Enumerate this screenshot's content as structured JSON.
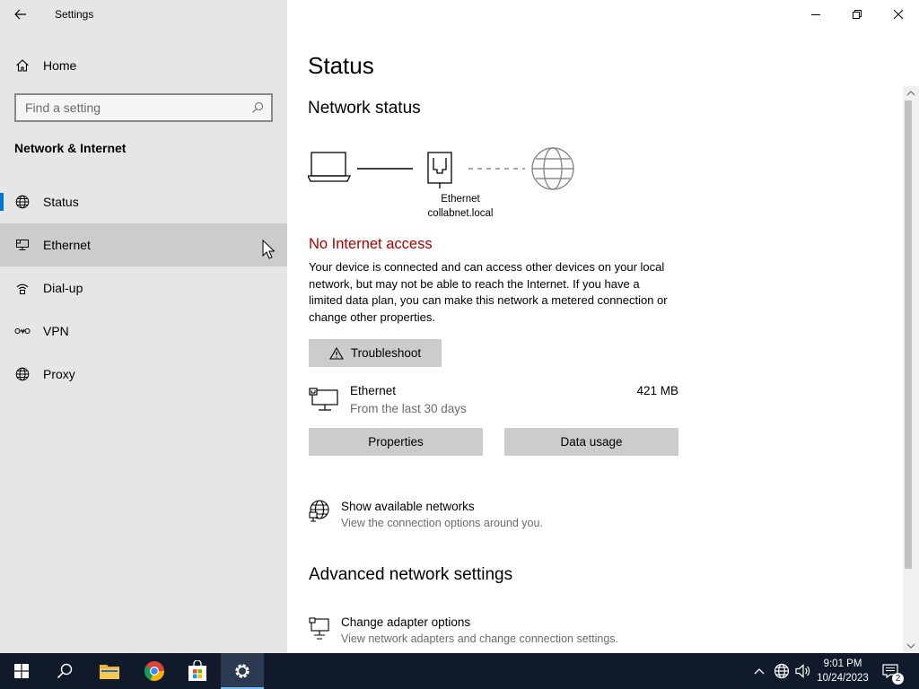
{
  "window": {
    "title": "Settings"
  },
  "sidebar": {
    "home_label": "Home",
    "search_placeholder": "Find a setting",
    "section_title": "Network & Internet",
    "items": [
      {
        "label": "Status",
        "icon": "globe-icon",
        "selected": true
      },
      {
        "label": "Ethernet",
        "icon": "ethernet-icon",
        "hovered": true
      },
      {
        "label": "Dial-up",
        "icon": "dialup-icon"
      },
      {
        "label": "VPN",
        "icon": "vpn-icon"
      },
      {
        "label": "Proxy",
        "icon": "globe-icon"
      }
    ]
  },
  "main": {
    "page_title": "Status",
    "network_status_heading": "Network status",
    "diagram": {
      "adapter_name": "Ethernet",
      "network_name": "collabnet.local"
    },
    "alert_title": "No Internet access",
    "description": "Your device is connected and can access other devices on your local network, but may not be able to reach the Internet. If you have a limited data plan, you can make this network a metered connection or change other properties.",
    "troubleshoot_label": "Troubleshoot",
    "connection": {
      "name": "Ethernet",
      "subtitle": "From the last 30 days",
      "data_used": "421 MB"
    },
    "properties_label": "Properties",
    "data_usage_label": "Data usage",
    "show_networks": {
      "title": "Show available networks",
      "subtitle": "View the connection options around you."
    },
    "advanced_heading": "Advanced network settings",
    "change_adapter": {
      "title": "Change adapter options",
      "subtitle": "View network adapters and change connection settings."
    }
  },
  "taskbar": {
    "time": "9:01 PM",
    "date": "10/24/2023",
    "notification_count": "2"
  },
  "colors": {
    "accent": "#0078d7",
    "alert": "#a80000",
    "sidebar_bg": "#e6e6e6",
    "taskbar_bg": "#101a2a"
  }
}
